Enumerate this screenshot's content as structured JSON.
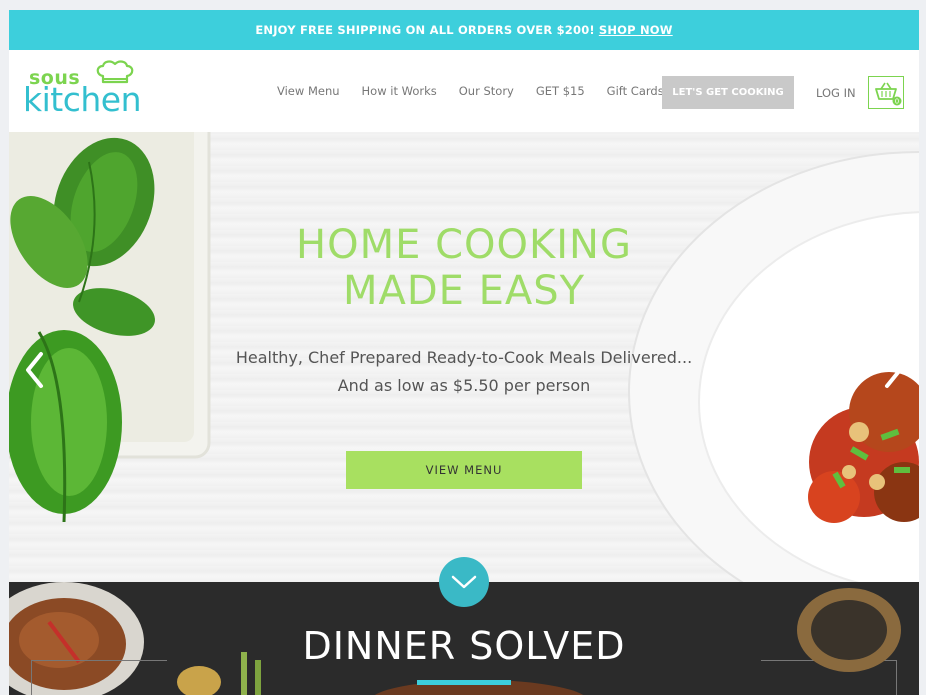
{
  "promo": {
    "text": "ENJOY FREE SHIPPING ON ALL ORDERS OVER $200!",
    "link": "SHOP NOW"
  },
  "logo": {
    "word1": "sous",
    "word2": "kitchen"
  },
  "nav": {
    "items": [
      "View Menu",
      "How it Works",
      "Our Story",
      "GET $15",
      "Gift Cards"
    ],
    "cta": "LET'S GET COOKING",
    "login": "LOG IN",
    "cart_count": "0"
  },
  "hero": {
    "title_line1": "HOME COOKING",
    "title_line2": "MADE EASY",
    "subtitle_line1": "Healthy, Chef Prepared Ready-to-Cook Meals Delivered...",
    "subtitle_line2": "And as low as $5.50 per person",
    "button": "VIEW MENU"
  },
  "section": {
    "title": "DINNER SOLVED"
  },
  "colors": {
    "teal": "#3dcfdc",
    "green": "#9fdc68",
    "button_green": "#a8e060",
    "cta_gray": "#c9c9c9",
    "dark_bg": "#2b2b2b"
  },
  "icons": [
    "chef-hat-icon",
    "cart-icon",
    "chevron-left-icon",
    "chevron-right-icon",
    "chevron-down-icon"
  ]
}
